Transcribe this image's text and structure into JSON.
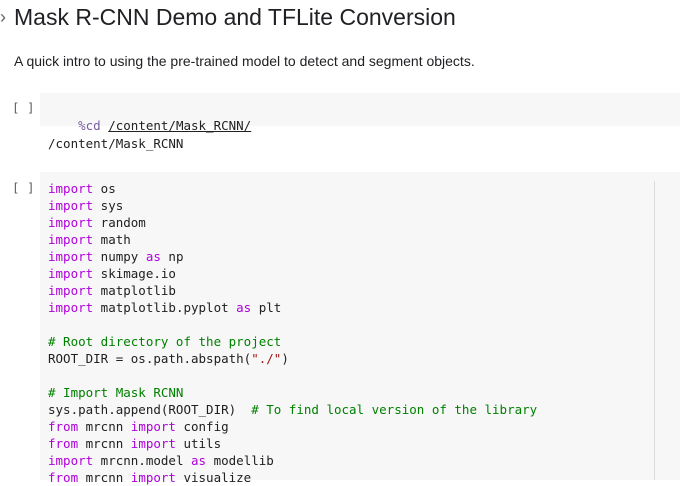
{
  "heading": {
    "title": "Mask R-CNN Demo and TFLite Conversion",
    "description": "A quick intro to using the pre-trained model to detect and segment objects."
  },
  "run_button_label": "[ ]",
  "cell1": {
    "magic": "%cd",
    "path": "/content/Mask_RCNN/",
    "output": "/content/Mask_RCNN"
  },
  "cell2": {
    "lines": [
      [
        [
          "kw",
          "import"
        ],
        [
          "",
          " os"
        ]
      ],
      [
        [
          "kw",
          "import"
        ],
        [
          "",
          " sys"
        ]
      ],
      [
        [
          "kw",
          "import"
        ],
        [
          "",
          " random"
        ]
      ],
      [
        [
          "kw",
          "import"
        ],
        [
          "",
          " math"
        ]
      ],
      [
        [
          "kw",
          "import"
        ],
        [
          "",
          " numpy "
        ],
        [
          "kw",
          "as"
        ],
        [
          "",
          " np"
        ]
      ],
      [
        [
          "kw",
          "import"
        ],
        [
          "",
          " skimage.io"
        ]
      ],
      [
        [
          "kw",
          "import"
        ],
        [
          "",
          " matplotlib"
        ]
      ],
      [
        [
          "kw",
          "import"
        ],
        [
          "",
          " matplotlib.pyplot "
        ],
        [
          "kw",
          "as"
        ],
        [
          "",
          " plt"
        ]
      ],
      [],
      [
        [
          "cm",
          "# Root directory of the project"
        ]
      ],
      [
        [
          "",
          "ROOT_DIR = os.path.abspath("
        ],
        [
          "str",
          "\"./\""
        ],
        [
          "",
          ")"
        ]
      ],
      [],
      [
        [
          "cm",
          "# Import Mask RCNN"
        ]
      ],
      [
        [
          "",
          "sys.path.append(ROOT_DIR)  "
        ],
        [
          "cm",
          "# To find local version of the library"
        ]
      ],
      [
        [
          "kw",
          "from"
        ],
        [
          "",
          " mrcnn "
        ],
        [
          "kw",
          "import"
        ],
        [
          "",
          " config"
        ]
      ],
      [
        [
          "kw",
          "from"
        ],
        [
          "",
          " mrcnn "
        ],
        [
          "kw",
          "import"
        ],
        [
          "",
          " utils"
        ]
      ],
      [
        [
          "kw",
          "import"
        ],
        [
          "",
          " mrcnn.model "
        ],
        [
          "kw",
          "as"
        ],
        [
          "",
          " modellib"
        ]
      ],
      [
        [
          "kw",
          "from"
        ],
        [
          "",
          " mrcnn "
        ],
        [
          "kw",
          "import"
        ],
        [
          "",
          " visualize"
        ]
      ]
    ]
  }
}
